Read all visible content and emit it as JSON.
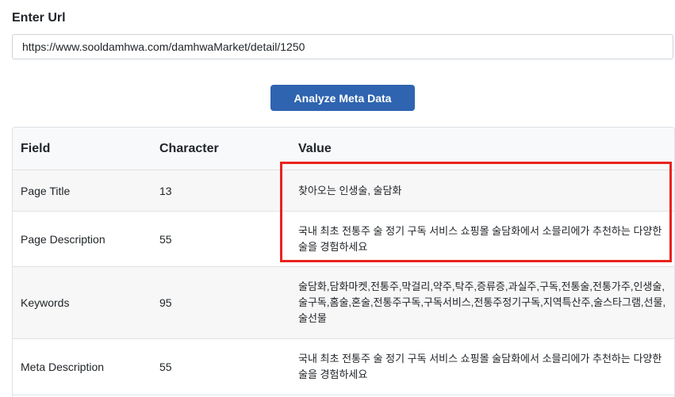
{
  "url_section": {
    "label": "Enter Url",
    "value": "https://www.sooldamhwa.com/damhwaMarket/detail/1250"
  },
  "analyze_button": {
    "label": "Analyze Meta Data",
    "color": "#2f64b0"
  },
  "table": {
    "headers": {
      "field": "Field",
      "character": "Character",
      "value": "Value"
    },
    "rows": [
      {
        "field": "Page Title",
        "character": "13",
        "value": "찾아오는 인생술, 술담화"
      },
      {
        "field": "Page Description",
        "character": "55",
        "value": "국내 최초 전통주 술 정기 구독 서비스 쇼핑몰 술담화에서 소믈리에가 추천하는 다양한 술을 경험하세요"
      },
      {
        "field": "Keywords",
        "character": "95",
        "value": "술담화,담화마켓,전통주,막걸리,약주,탁주,증류증,과실주,구독,전통술,전통가주,인생술,술구독,홈술,혼술,전통주구독,구독서비스,전통주정기구독,지역특산주,술스타그램,선물,술선물"
      },
      {
        "field": "Meta Description",
        "character": "55",
        "value": "국내 최초 전통주 술 정기 구독 서비스 쇼핑몰 술담화에서 소믈리에가 추천하는 다양한 술을 경험하세요"
      }
    ]
  },
  "highlight_color": "#e8231d"
}
